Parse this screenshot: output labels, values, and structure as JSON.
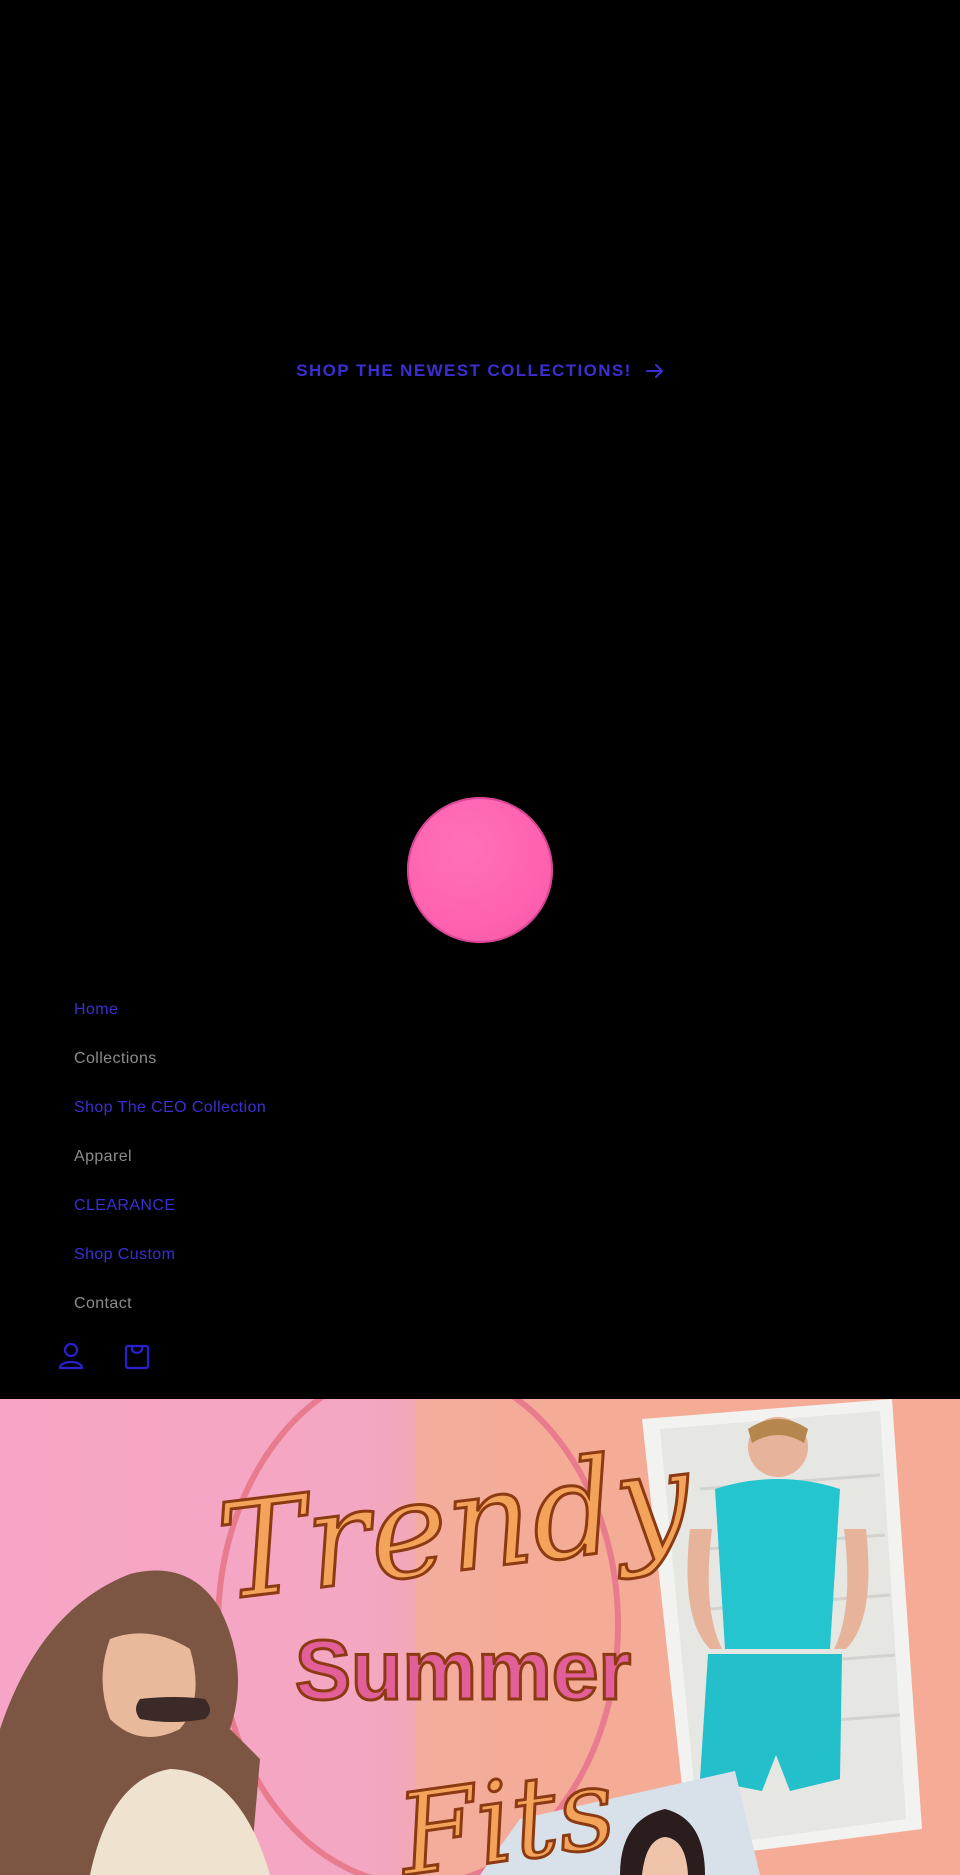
{
  "announcement": {
    "text": "SHOP THE NEWEST COLLECTIONS!",
    "icon": "arrow-right-icon",
    "color": "#3b2fd1"
  },
  "logo": {
    "color": "#ff66b3"
  },
  "nav": {
    "items": [
      {
        "label": "Home"
      },
      {
        "label": "Collections"
      },
      {
        "label": "Shop The CEO Collection"
      },
      {
        "label": "Apparel"
      },
      {
        "label": "CLEARANCE"
      },
      {
        "label": "Shop Custom"
      },
      {
        "label": "Contact"
      }
    ]
  },
  "header_icons": {
    "account": "account-icon",
    "cart": "cart-icon"
  },
  "hero": {
    "line1": "Trendy",
    "line2": "Summer",
    "line3": "Fits"
  }
}
